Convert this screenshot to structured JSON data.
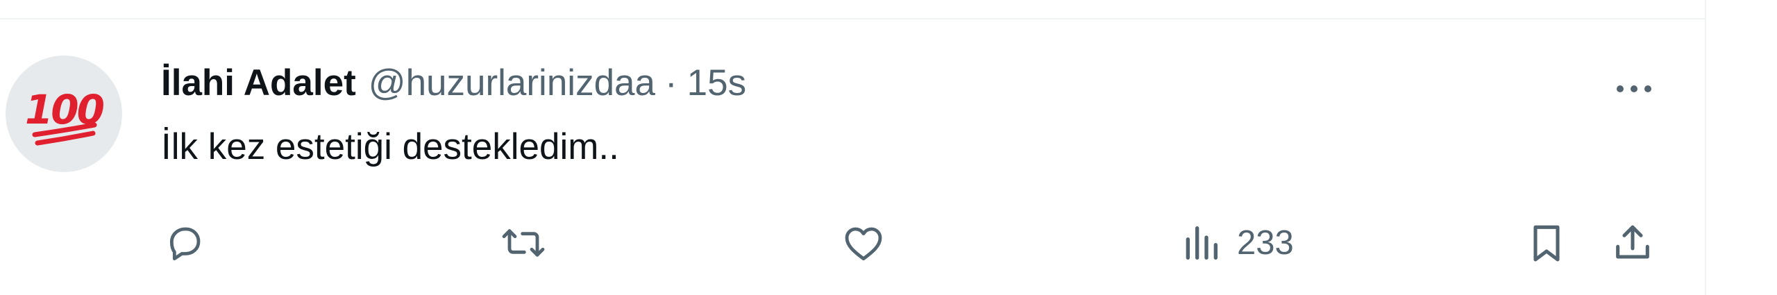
{
  "tweet": {
    "display_name": "İlahi Adalet",
    "handle": "@huzurlarinizdaa",
    "separator": "·",
    "time": "15s",
    "text": "İlk kez estetiği destekledim..",
    "avatar": {
      "icon": "hundred-points-emoji",
      "glyph_text": "100",
      "color": "#e0202e",
      "background": "#e7eaec"
    }
  },
  "actions": {
    "reply": {
      "icon": "reply-icon"
    },
    "retweet": {
      "icon": "retweet-icon"
    },
    "like": {
      "icon": "heart-icon"
    },
    "views": {
      "icon": "views-chart-icon",
      "count": "233"
    },
    "bookmark": {
      "icon": "bookmark-icon"
    },
    "share": {
      "icon": "share-icon"
    },
    "more": {
      "icon": "more-horizontal-icon"
    }
  },
  "colors": {
    "text_primary": "#0f1419",
    "text_secondary": "#536471",
    "divider": "#eff3f4"
  }
}
